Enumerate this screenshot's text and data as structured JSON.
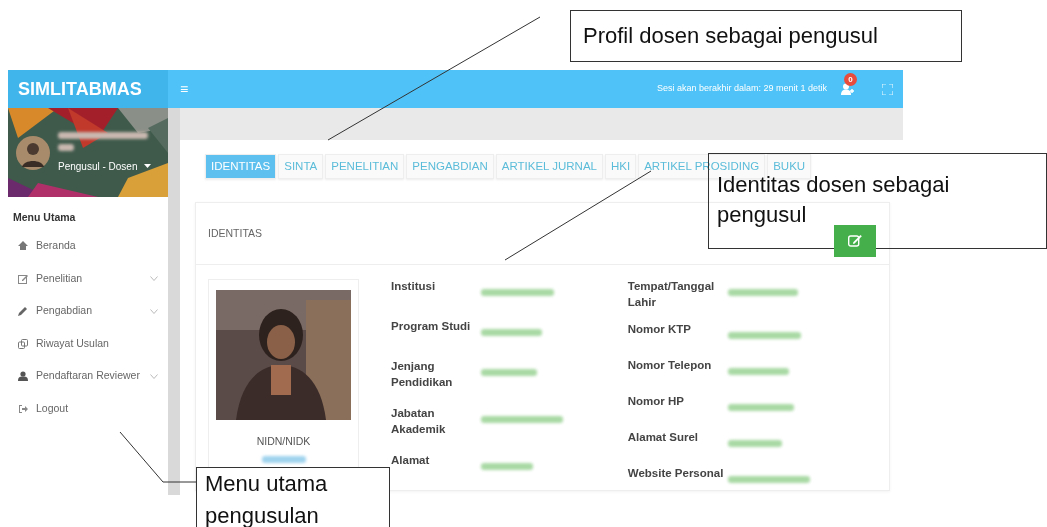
{
  "annotations": [
    {
      "kind": "top",
      "text": "Profil dosen sebagai pengusul"
    },
    {
      "kind": "right",
      "text": "Identitas dosen sebagai pengusul"
    },
    {
      "kind": "bottom",
      "text": "Menu utama pengusulan"
    }
  ],
  "header": {
    "brand": "SIMLITABMAS",
    "menu_toggle": "≡",
    "session": "Sesi akan berakhir dalam: 29 menit 1 detik",
    "notification_count": "0"
  },
  "sidebar": {
    "role": "Pengusul - Dosen",
    "section": "Menu Utama",
    "items": [
      {
        "kind": "home",
        "label": "Beranda",
        "expandable": false
      },
      {
        "kind": "edit",
        "label": "Penelitian",
        "expandable": true
      },
      {
        "kind": "pencil",
        "label": "Pengabdian",
        "expandable": true
      },
      {
        "kind": "copy",
        "label": "Riwayat Usulan",
        "expandable": false
      },
      {
        "kind": "user",
        "label": "Pendaftaran Reviewer",
        "expandable": true
      },
      {
        "kind": "logout",
        "label": "Logout",
        "expandable": false
      }
    ]
  },
  "tabs": [
    {
      "label": "IDENTITAS",
      "selected": true
    },
    {
      "label": "SINTA",
      "selected": false
    },
    {
      "label": "PENELITIAN",
      "selected": false
    },
    {
      "label": "PENGABDIAN",
      "selected": false
    },
    {
      "label": "ARTIKEL JURNAL",
      "selected": false
    },
    {
      "label": "HKI",
      "selected": false
    },
    {
      "label": "ARTIKEL PROSIDING",
      "selected": false
    },
    {
      "label": "BUKU",
      "selected": false
    }
  ],
  "card": {
    "title": "IDENTITAS",
    "id_label": "NIDN/NIDK",
    "left_fields": [
      {
        "label": "Institusi"
      },
      {
        "label": "Program Studi"
      },
      {
        "label": "Jenjang Pendidikan"
      },
      {
        "label": "Jabatan Akademik"
      },
      {
        "label": "Alamat"
      }
    ],
    "right_fields": [
      {
        "label": "Tempat/Tanggal Lahir"
      },
      {
        "label": "Nomor KTP"
      },
      {
        "label": "Nomor Telepon"
      },
      {
        "label": "Nomor HP"
      },
      {
        "label": "Alamat Surel"
      },
      {
        "label": "Website Personal"
      }
    ]
  }
}
